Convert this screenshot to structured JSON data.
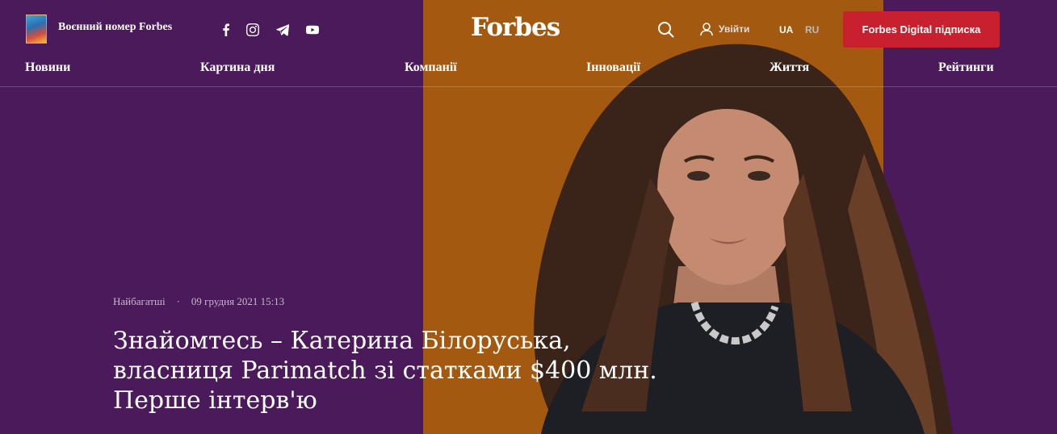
{
  "colors": {
    "purple": "#4a1a5a",
    "orange": "#a35a10",
    "accent": "#c8202f"
  },
  "header": {
    "magazine_label": "Воєнний номер Forbes",
    "logo": "Forbes",
    "login_label": "Увійти",
    "lang_ua": "UA",
    "lang_ru": "RU",
    "subscribe_label": "Forbes Digital підписка",
    "social_icons": [
      "facebook-icon",
      "instagram-icon",
      "telegram-icon",
      "youtube-icon"
    ]
  },
  "nav": {
    "items": [
      {
        "label": "Новини"
      },
      {
        "label": "Картина дня"
      },
      {
        "label": "Компанії"
      },
      {
        "label": "Інновації"
      },
      {
        "label": "Життя"
      },
      {
        "label": "Рейтинги"
      }
    ]
  },
  "article": {
    "category": "Найбагатші",
    "separator": "·",
    "date": "09 грудня 2021 15:13",
    "headline_lines": [
      "Знайомтесь – Катерина Білоруська,",
      "власниця Parimatch зі статками $400 млн.",
      "Перше інтерв'ю"
    ]
  }
}
